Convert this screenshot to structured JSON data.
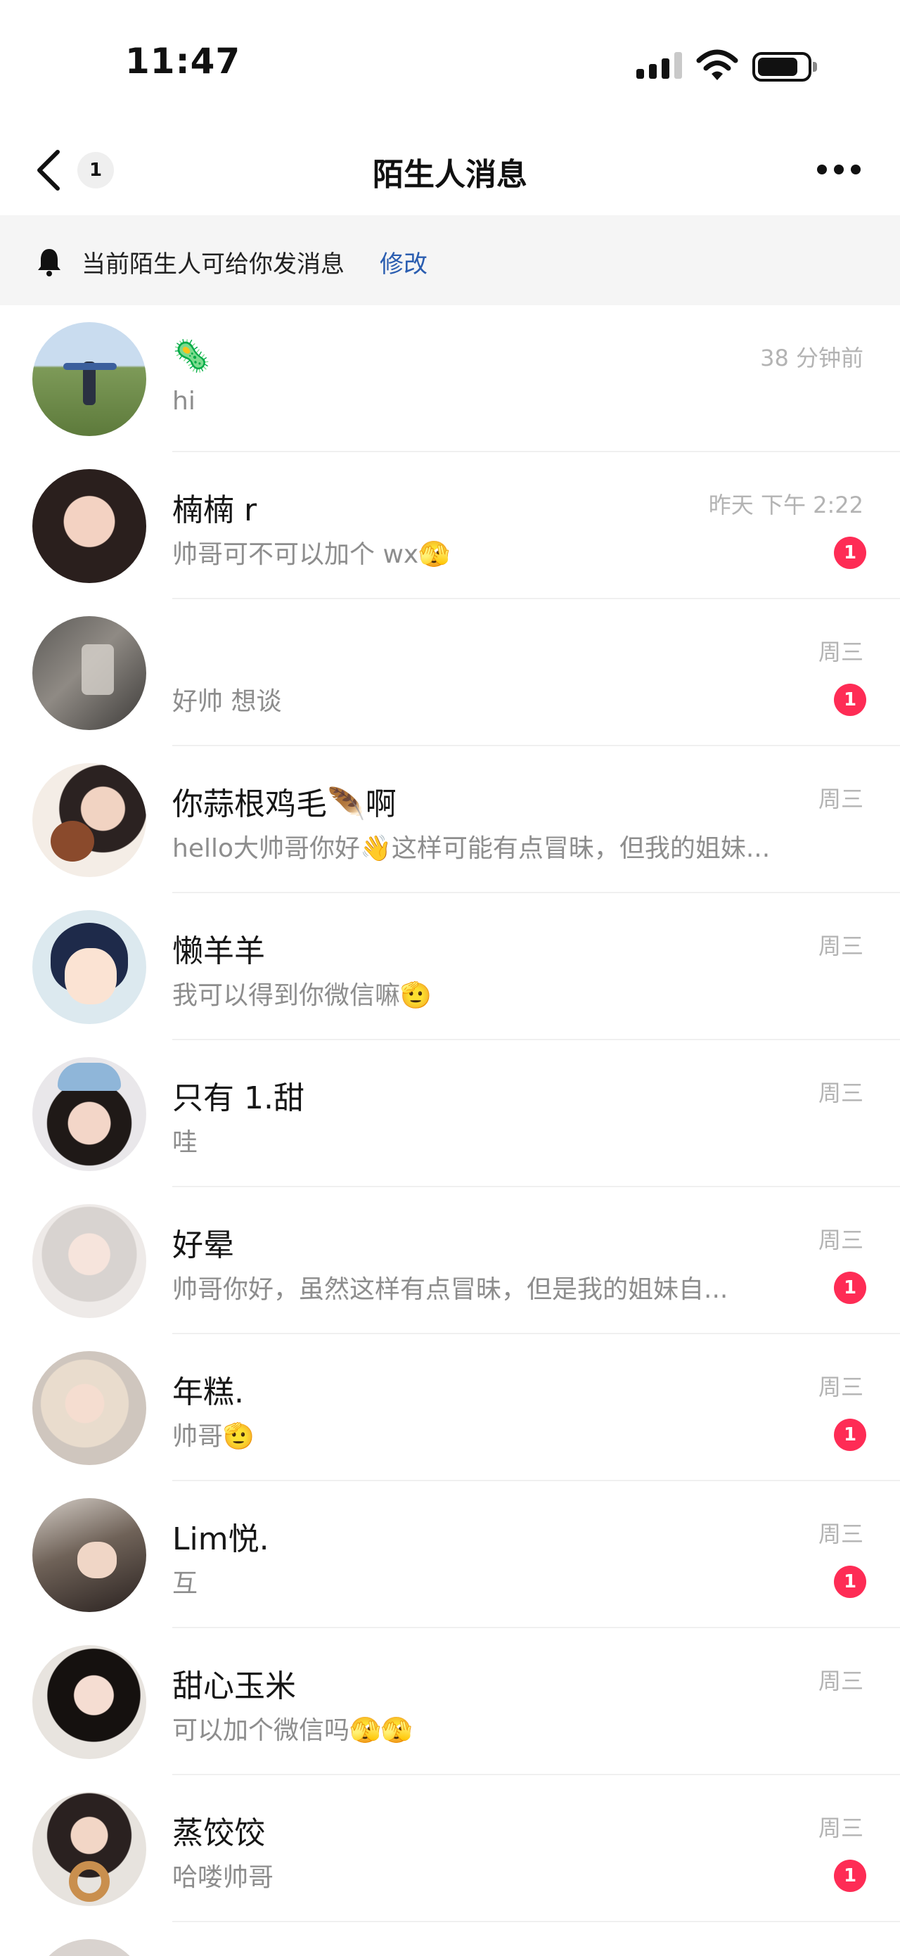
{
  "status": {
    "time": "11:47"
  },
  "nav": {
    "back_count": "1",
    "title": "陌生人消息"
  },
  "notice": {
    "text": "当前陌生人可给你发消息",
    "link": "修改"
  },
  "colors": {
    "badge": "#fe2c55",
    "link": "#2a5db0",
    "muted": "#8d8d8d",
    "time": "#b3b3b3"
  },
  "messages": [
    {
      "name": "🦠",
      "time": "38 分钟前",
      "preview": "hi",
      "unread": ""
    },
    {
      "name": "楠楠 r",
      "time": "昨天 下午 2:22",
      "preview": "帅哥可不可以加个 wx🫣",
      "unread": "1"
    },
    {
      "name": "",
      "time": "周三",
      "preview": "好帅 想谈",
      "unread": "1"
    },
    {
      "name": "你蒜根鸡毛🪶啊",
      "time": "周三",
      "preview": "hello大帅哥你好👋这样可能有点冒昧，但我的姐妹...",
      "unread": ""
    },
    {
      "name": "懒羊羊",
      "time": "周三",
      "preview": "我可以得到你微信嘛🫡",
      "unread": ""
    },
    {
      "name": "只有 1.甜",
      "time": "周三",
      "preview": "哇",
      "unread": ""
    },
    {
      "name": "好晕",
      "time": "周三",
      "preview": "帅哥你好，虽然这样有点冒昧，但是我的姐妹自...",
      "unread": "1"
    },
    {
      "name": "年糕.",
      "time": "周三",
      "preview": "帅哥🫡",
      "unread": "1"
    },
    {
      "name": "Lim悦.",
      "time": "周三",
      "preview": "互",
      "unread": "1"
    },
    {
      "name": "甜心玉米",
      "time": "周三",
      "preview": "可以加个微信吗🫣🫣",
      "unread": ""
    },
    {
      "name": "蒸饺饺",
      "time": "周三",
      "preview": "哈喽帅哥",
      "unread": "1"
    }
  ]
}
